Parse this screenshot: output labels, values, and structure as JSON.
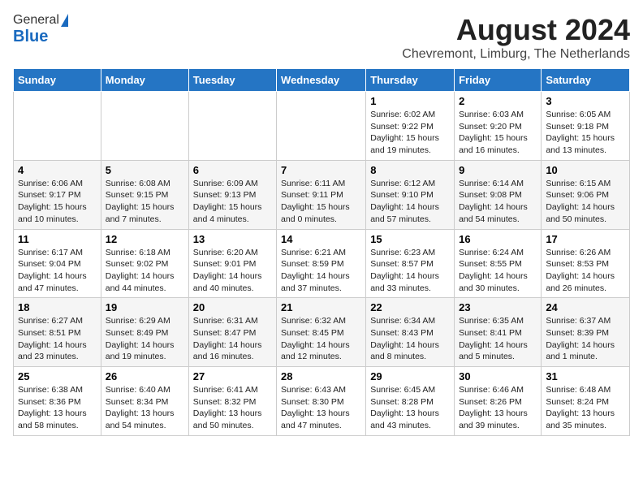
{
  "logo": {
    "general": "General",
    "blue": "Blue"
  },
  "title": "August 2024",
  "location": "Chevremont, Limburg, The Netherlands",
  "weekdays": [
    "Sunday",
    "Monday",
    "Tuesday",
    "Wednesday",
    "Thursday",
    "Friday",
    "Saturday"
  ],
  "weeks": [
    [
      {
        "day": "",
        "info": ""
      },
      {
        "day": "",
        "info": ""
      },
      {
        "day": "",
        "info": ""
      },
      {
        "day": "",
        "info": ""
      },
      {
        "day": "1",
        "info": "Sunrise: 6:02 AM\nSunset: 9:22 PM\nDaylight: 15 hours\nand 19 minutes."
      },
      {
        "day": "2",
        "info": "Sunrise: 6:03 AM\nSunset: 9:20 PM\nDaylight: 15 hours\nand 16 minutes."
      },
      {
        "day": "3",
        "info": "Sunrise: 6:05 AM\nSunset: 9:18 PM\nDaylight: 15 hours\nand 13 minutes."
      }
    ],
    [
      {
        "day": "4",
        "info": "Sunrise: 6:06 AM\nSunset: 9:17 PM\nDaylight: 15 hours\nand 10 minutes."
      },
      {
        "day": "5",
        "info": "Sunrise: 6:08 AM\nSunset: 9:15 PM\nDaylight: 15 hours\nand 7 minutes."
      },
      {
        "day": "6",
        "info": "Sunrise: 6:09 AM\nSunset: 9:13 PM\nDaylight: 15 hours\nand 4 minutes."
      },
      {
        "day": "7",
        "info": "Sunrise: 6:11 AM\nSunset: 9:11 PM\nDaylight: 15 hours\nand 0 minutes."
      },
      {
        "day": "8",
        "info": "Sunrise: 6:12 AM\nSunset: 9:10 PM\nDaylight: 14 hours\nand 57 minutes."
      },
      {
        "day": "9",
        "info": "Sunrise: 6:14 AM\nSunset: 9:08 PM\nDaylight: 14 hours\nand 54 minutes."
      },
      {
        "day": "10",
        "info": "Sunrise: 6:15 AM\nSunset: 9:06 PM\nDaylight: 14 hours\nand 50 minutes."
      }
    ],
    [
      {
        "day": "11",
        "info": "Sunrise: 6:17 AM\nSunset: 9:04 PM\nDaylight: 14 hours\nand 47 minutes."
      },
      {
        "day": "12",
        "info": "Sunrise: 6:18 AM\nSunset: 9:02 PM\nDaylight: 14 hours\nand 44 minutes."
      },
      {
        "day": "13",
        "info": "Sunrise: 6:20 AM\nSunset: 9:01 PM\nDaylight: 14 hours\nand 40 minutes."
      },
      {
        "day": "14",
        "info": "Sunrise: 6:21 AM\nSunset: 8:59 PM\nDaylight: 14 hours\nand 37 minutes."
      },
      {
        "day": "15",
        "info": "Sunrise: 6:23 AM\nSunset: 8:57 PM\nDaylight: 14 hours\nand 33 minutes."
      },
      {
        "day": "16",
        "info": "Sunrise: 6:24 AM\nSunset: 8:55 PM\nDaylight: 14 hours\nand 30 minutes."
      },
      {
        "day": "17",
        "info": "Sunrise: 6:26 AM\nSunset: 8:53 PM\nDaylight: 14 hours\nand 26 minutes."
      }
    ],
    [
      {
        "day": "18",
        "info": "Sunrise: 6:27 AM\nSunset: 8:51 PM\nDaylight: 14 hours\nand 23 minutes."
      },
      {
        "day": "19",
        "info": "Sunrise: 6:29 AM\nSunset: 8:49 PM\nDaylight: 14 hours\nand 19 minutes."
      },
      {
        "day": "20",
        "info": "Sunrise: 6:31 AM\nSunset: 8:47 PM\nDaylight: 14 hours\nand 16 minutes."
      },
      {
        "day": "21",
        "info": "Sunrise: 6:32 AM\nSunset: 8:45 PM\nDaylight: 14 hours\nand 12 minutes."
      },
      {
        "day": "22",
        "info": "Sunrise: 6:34 AM\nSunset: 8:43 PM\nDaylight: 14 hours\nand 8 minutes."
      },
      {
        "day": "23",
        "info": "Sunrise: 6:35 AM\nSunset: 8:41 PM\nDaylight: 14 hours\nand 5 minutes."
      },
      {
        "day": "24",
        "info": "Sunrise: 6:37 AM\nSunset: 8:39 PM\nDaylight: 14 hours\nand 1 minute."
      }
    ],
    [
      {
        "day": "25",
        "info": "Sunrise: 6:38 AM\nSunset: 8:36 PM\nDaylight: 13 hours\nand 58 minutes."
      },
      {
        "day": "26",
        "info": "Sunrise: 6:40 AM\nSunset: 8:34 PM\nDaylight: 13 hours\nand 54 minutes."
      },
      {
        "day": "27",
        "info": "Sunrise: 6:41 AM\nSunset: 8:32 PM\nDaylight: 13 hours\nand 50 minutes."
      },
      {
        "day": "28",
        "info": "Sunrise: 6:43 AM\nSunset: 8:30 PM\nDaylight: 13 hours\nand 47 minutes."
      },
      {
        "day": "29",
        "info": "Sunrise: 6:45 AM\nSunset: 8:28 PM\nDaylight: 13 hours\nand 43 minutes."
      },
      {
        "day": "30",
        "info": "Sunrise: 6:46 AM\nSunset: 8:26 PM\nDaylight: 13 hours\nand 39 minutes."
      },
      {
        "day": "31",
        "info": "Sunrise: 6:48 AM\nSunset: 8:24 PM\nDaylight: 13 hours\nand 35 minutes."
      }
    ]
  ]
}
